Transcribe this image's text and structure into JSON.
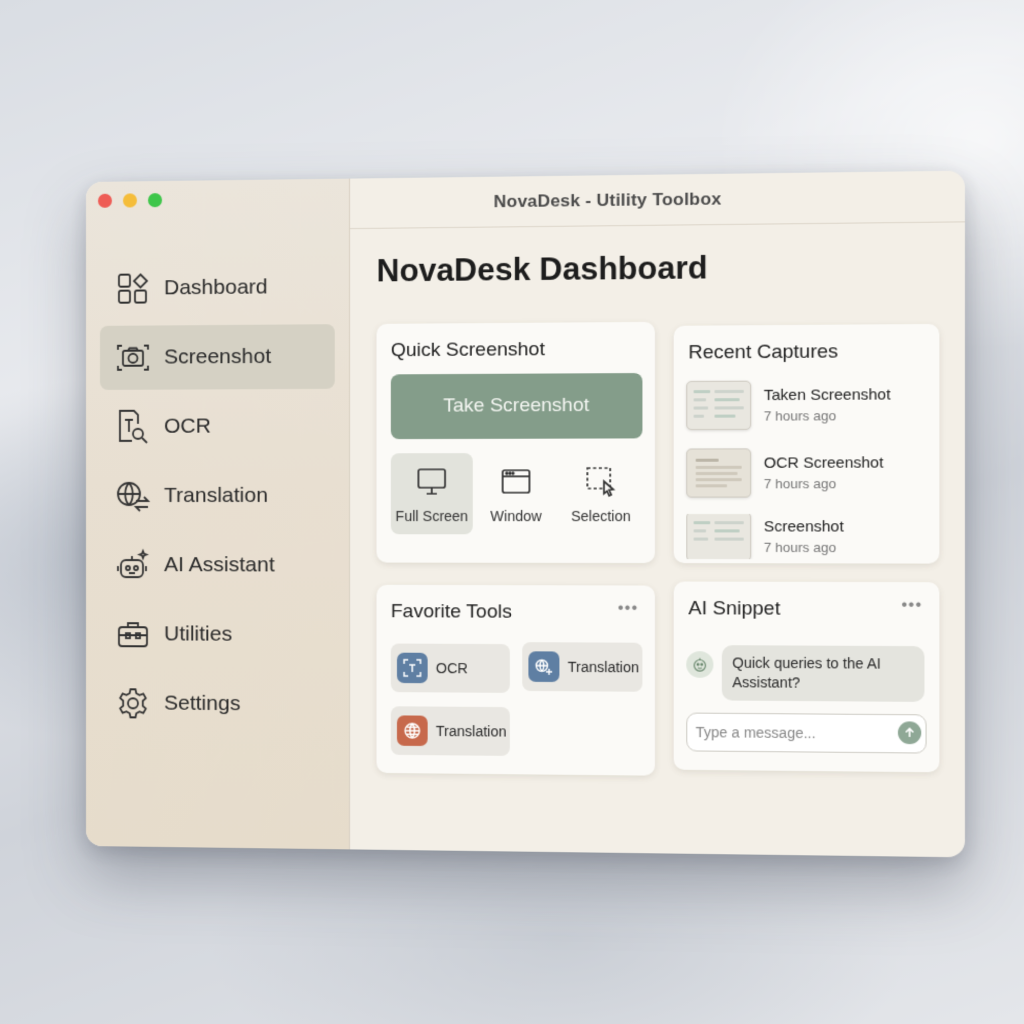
{
  "window": {
    "title": "NovaDesk - Utility Toolbox"
  },
  "sidebar": {
    "items": [
      {
        "label": "Dashboard",
        "icon": "dashboard-grid-icon"
      },
      {
        "label": "Screenshot",
        "icon": "camera-icon",
        "active": true
      },
      {
        "label": "OCR",
        "icon": "ocr-scan-icon"
      },
      {
        "label": "Translation",
        "icon": "globe-translate-icon"
      },
      {
        "label": "AI Assistant",
        "icon": "robot-icon"
      },
      {
        "label": "Utilities",
        "icon": "toolbox-icon"
      },
      {
        "label": "Settings",
        "icon": "gear-icon"
      }
    ]
  },
  "main": {
    "title_bold": "NovaDesk",
    "title_rest": " Dashboard",
    "quick_screenshot": {
      "title": "Quick Screenshot",
      "button": "Take Screenshot",
      "modes": [
        {
          "label": "Full Screen",
          "icon": "monitor-icon",
          "active": true
        },
        {
          "label": "Window",
          "icon": "window-icon"
        },
        {
          "label": "Selection",
          "icon": "selection-cursor-icon"
        }
      ]
    },
    "recent_captures": {
      "title": "Recent Captures",
      "items": [
        {
          "name": "Taken Screenshot",
          "time": "7 hours ago"
        },
        {
          "name": "OCR Screenshot",
          "time": "7 hours ago"
        },
        {
          "name": "Screenshot",
          "time": "7 hours ago"
        }
      ]
    },
    "favorite_tools": {
      "title": "Favorite Tools",
      "more": "•••",
      "tools": [
        {
          "label": "OCR",
          "icon": "ocr-icon",
          "color": "#5f7fa3"
        },
        {
          "label": "Translation",
          "icon": "translate-icon",
          "color": "#5f7fa3"
        },
        {
          "label": "Translation",
          "icon": "globe-icon",
          "color": "#c7694c"
        }
      ]
    },
    "ai_snippet": {
      "title": "AI Snippet",
      "more": "•••",
      "message": "Quick queries to the AI Assistant?",
      "input_placeholder": "Type a message..."
    }
  },
  "colors": {
    "accent": "#849d8a",
    "sidebar_active": "#d5d1c4",
    "close": "#ee5c55",
    "minimize": "#f5bd3a",
    "maximize": "#3ec64a"
  }
}
